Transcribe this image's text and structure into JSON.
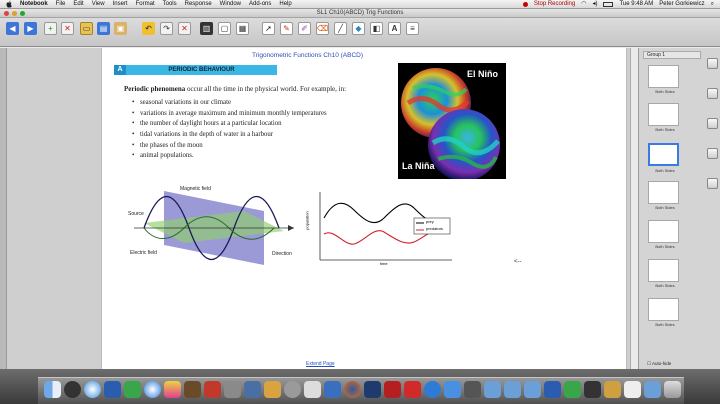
{
  "menubar": {
    "app": "Notebook",
    "items": [
      "File",
      "Edit",
      "View",
      "Insert",
      "Format",
      "Tools",
      "Response",
      "Window",
      "Add-ons",
      "Help"
    ],
    "recording": "Stop Recording",
    "clock": "Tue 9:48 AM",
    "user": "Peter Gorkiewicz"
  },
  "window": {
    "title": "SL1 Ch10(ABCD) Trig Functions"
  },
  "page": {
    "title": "Trigonometric Functions Ch10 (ABCD)",
    "section_letter": "A",
    "section_title": "PERIODIC BEHAVIOUR",
    "intro_bold": "Periodic phenomena",
    "intro_rest": " occur all the time in the physical world.  For example, in:",
    "bullets": [
      "seasonal variations in our climate",
      "variations in average maximum and minimum monthly temperatures",
      "the number of daylight hours at a particular location",
      "tidal variations in the depth of water in a harbour",
      "the phases of the moon",
      "animal populations."
    ],
    "nino_label": "El Niño",
    "nina_label": "La Niña",
    "wave_labels": {
      "magnetic": "Magnetic field",
      "source": "Source",
      "electric": "Electric field",
      "direction": "Direction"
    },
    "graph": {
      "ylabel": "population",
      "xlabel": "time",
      "legend": [
        "prey",
        "predators"
      ]
    },
    "extend_link": "Extend Page",
    "cursor_mark": "<--"
  },
  "sidebar": {
    "group": "Group 1",
    "thumbs": [
      "Both Sides",
      "Both Sides",
      "Both Sides",
      "Both Sides",
      "Both Sides",
      "Both Sides",
      "Both Sides"
    ],
    "autohide": "Auto-hide"
  },
  "colors": {
    "section_bar": "#3bb7e6",
    "title_blue": "#2b4fb0",
    "prey": "#000000",
    "predators": "#d0202a"
  }
}
